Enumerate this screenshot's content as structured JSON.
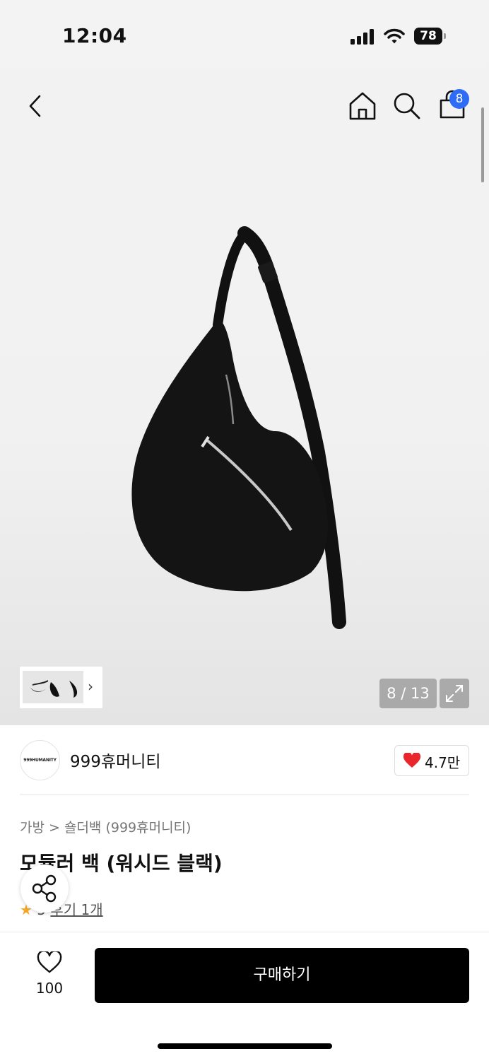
{
  "status_bar": {
    "time": "12:04",
    "battery": "78"
  },
  "header": {
    "cart_count": "8"
  },
  "gallery": {
    "counter": "8 / 13"
  },
  "brand": {
    "logo_text": "999HUMANITY",
    "name": "999휴머니티",
    "like_count": "4.7만"
  },
  "product": {
    "breadcrumb": "가방 > 숄더백 (999휴머니티)",
    "title": "모듈러 백 (워시드 블랙)",
    "rating": "5",
    "review_link": "후기 1개"
  },
  "bottom_bar": {
    "wish_count": "100",
    "buy_label": "구매하기"
  },
  "colors": {
    "accent_badge": "#2f6cf5",
    "heart": "#e8262c",
    "star": "#f5a623",
    "buy_button": "#000000"
  }
}
